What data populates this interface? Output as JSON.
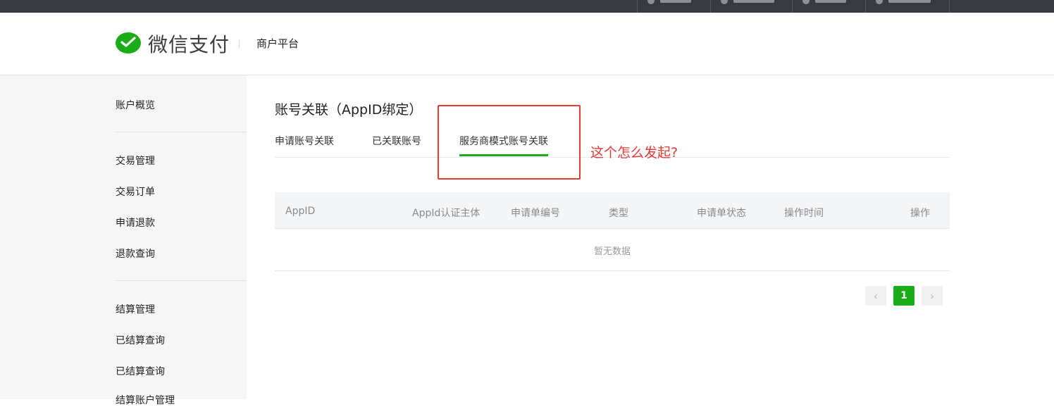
{
  "header": {
    "brand": "微信支付",
    "platform": "商户平台"
  },
  "sidebar": {
    "items": [
      {
        "label": "账户概览"
      },
      {
        "label": "交易管理"
      },
      {
        "label": "交易订单"
      },
      {
        "label": "申请退款"
      },
      {
        "label": "退款查询"
      },
      {
        "label": "结算管理"
      },
      {
        "label": "已结算查询"
      },
      {
        "label": "已结算查询"
      },
      {
        "label": "结算账户管理"
      }
    ]
  },
  "main": {
    "title": "账号关联（AppID绑定）",
    "tabs": [
      {
        "label": "申请账号关联"
      },
      {
        "label": "已关联账号"
      },
      {
        "label": "服务商模式账号关联",
        "active": true
      }
    ],
    "annotation": "这个怎么发起?",
    "table": {
      "columns": [
        "AppID",
        "AppId认证主体",
        "申请单编号",
        "类型",
        "申请单状态",
        "操作时间",
        "操作"
      ],
      "empty_text": "暂无数据"
    },
    "pagination": {
      "current_page": "1",
      "prev": "‹",
      "next": "›"
    }
  },
  "colors": {
    "accent": "#1aad19",
    "annotation": "#e53935",
    "topbar": "#373a40"
  }
}
